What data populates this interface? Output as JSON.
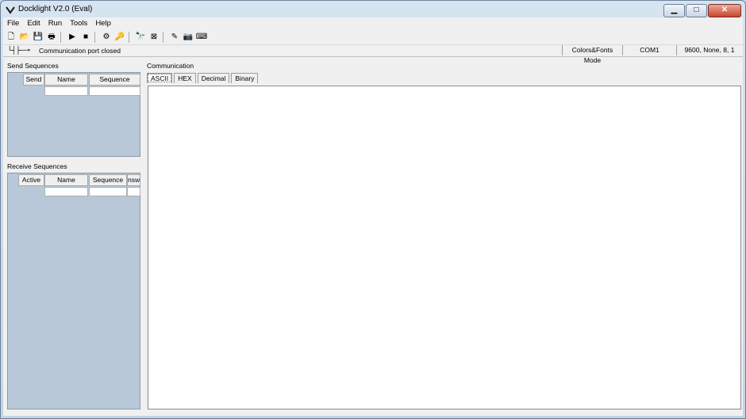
{
  "window": {
    "title": "Docklight V2.0 (Eval)",
    "minimize_glyph": "▁",
    "maximize_glyph": "□",
    "close_glyph": "✕"
  },
  "menu": [
    "File",
    "Edit",
    "Run",
    "Tools",
    "Help"
  ],
  "toolbar": {
    "buttons": [
      {
        "name": "new-file-icon",
        "glyph": "🗋"
      },
      {
        "name": "open-folder-icon",
        "glyph": "📂"
      },
      {
        "name": "save-icon",
        "glyph": "💾"
      },
      {
        "name": "print-icon",
        "glyph": "🖶"
      },
      {
        "name": "run-icon",
        "glyph": "▶"
      },
      {
        "name": "stop-icon",
        "glyph": "■"
      },
      {
        "name": "settings-icon",
        "glyph": "⚙"
      },
      {
        "name": "key-icon",
        "glyph": "🔑"
      },
      {
        "name": "find-icon",
        "glyph": "🔭"
      },
      {
        "name": "clear-icon",
        "glyph": "⊠"
      },
      {
        "name": "edit-icon",
        "glyph": "✎"
      },
      {
        "name": "snapshot-icon",
        "glyph": "📷"
      },
      {
        "name": "keyboard-icon",
        "glyph": "⌨"
      }
    ]
  },
  "status": {
    "port_icon": "└┤├─⊸",
    "port_text": "Communication port closed",
    "mode": "Colors&Fonts Mode",
    "port": "COM1",
    "settings": "9600, None, 8, 1"
  },
  "send": {
    "label": "Send Sequences",
    "columns": [
      "Send",
      "Name",
      "Sequence"
    ]
  },
  "receive": {
    "label": "Receive Sequences",
    "columns": [
      "Active",
      "Name",
      "Sequence",
      "nsw"
    ]
  },
  "communication": {
    "label": "Communication",
    "tabs": [
      "ASCII",
      "HEX",
      "Decimal",
      "Binary"
    ]
  }
}
